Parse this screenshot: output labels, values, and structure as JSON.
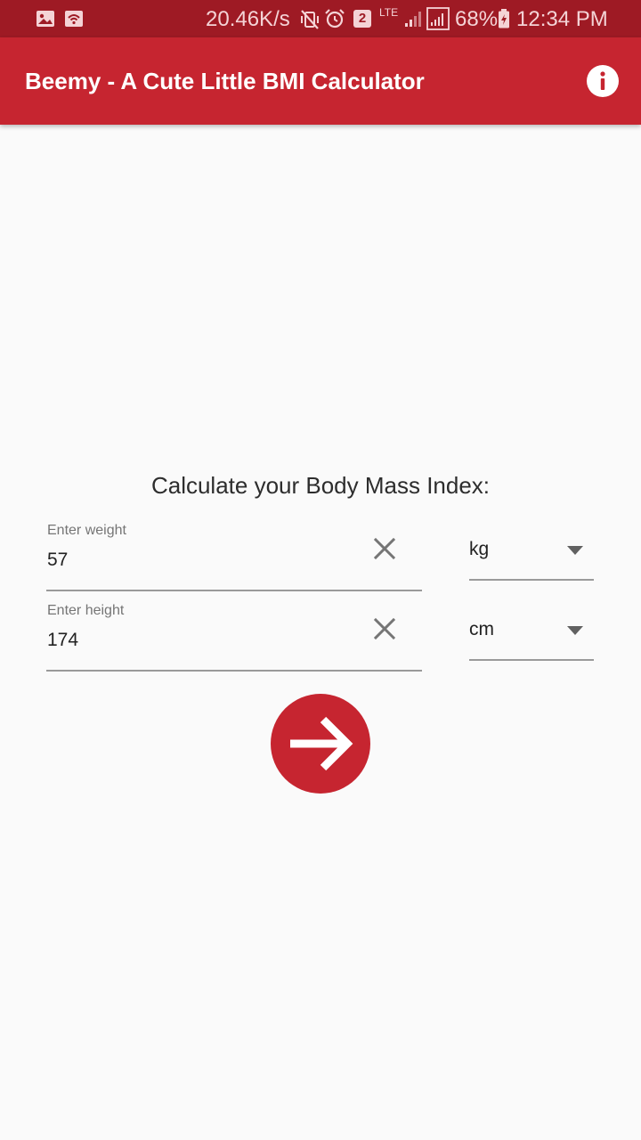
{
  "status_bar": {
    "network_speed": "20.46K/s",
    "notification_count": "2",
    "network_type": "LTE",
    "battery": "68%",
    "time": "12:34 PM",
    "icons": [
      "image-icon",
      "wifi-calling-icon",
      "vibrate-mute-icon",
      "alarm-icon",
      "sim-2-icon",
      "signal-icon",
      "signal-icon",
      "battery-charging-icon"
    ]
  },
  "app_bar": {
    "title": "Beemy - A Cute Little BMI Calculator",
    "action_icon": "info-icon"
  },
  "form": {
    "heading": "Calculate your Body Mass Index:",
    "weight": {
      "label": "Enter weight",
      "value": "57",
      "unit": "kg"
    },
    "height": {
      "label": "Enter height",
      "value": "174",
      "unit": "cm"
    },
    "submit_icon": "arrow-right-icon"
  },
  "colors": {
    "status_bar": "#9e1a24",
    "primary": "#c62530",
    "background": "#fafafa",
    "text": "#2d2d2d",
    "hint": "#757575",
    "underline": "#9a9a9a"
  }
}
